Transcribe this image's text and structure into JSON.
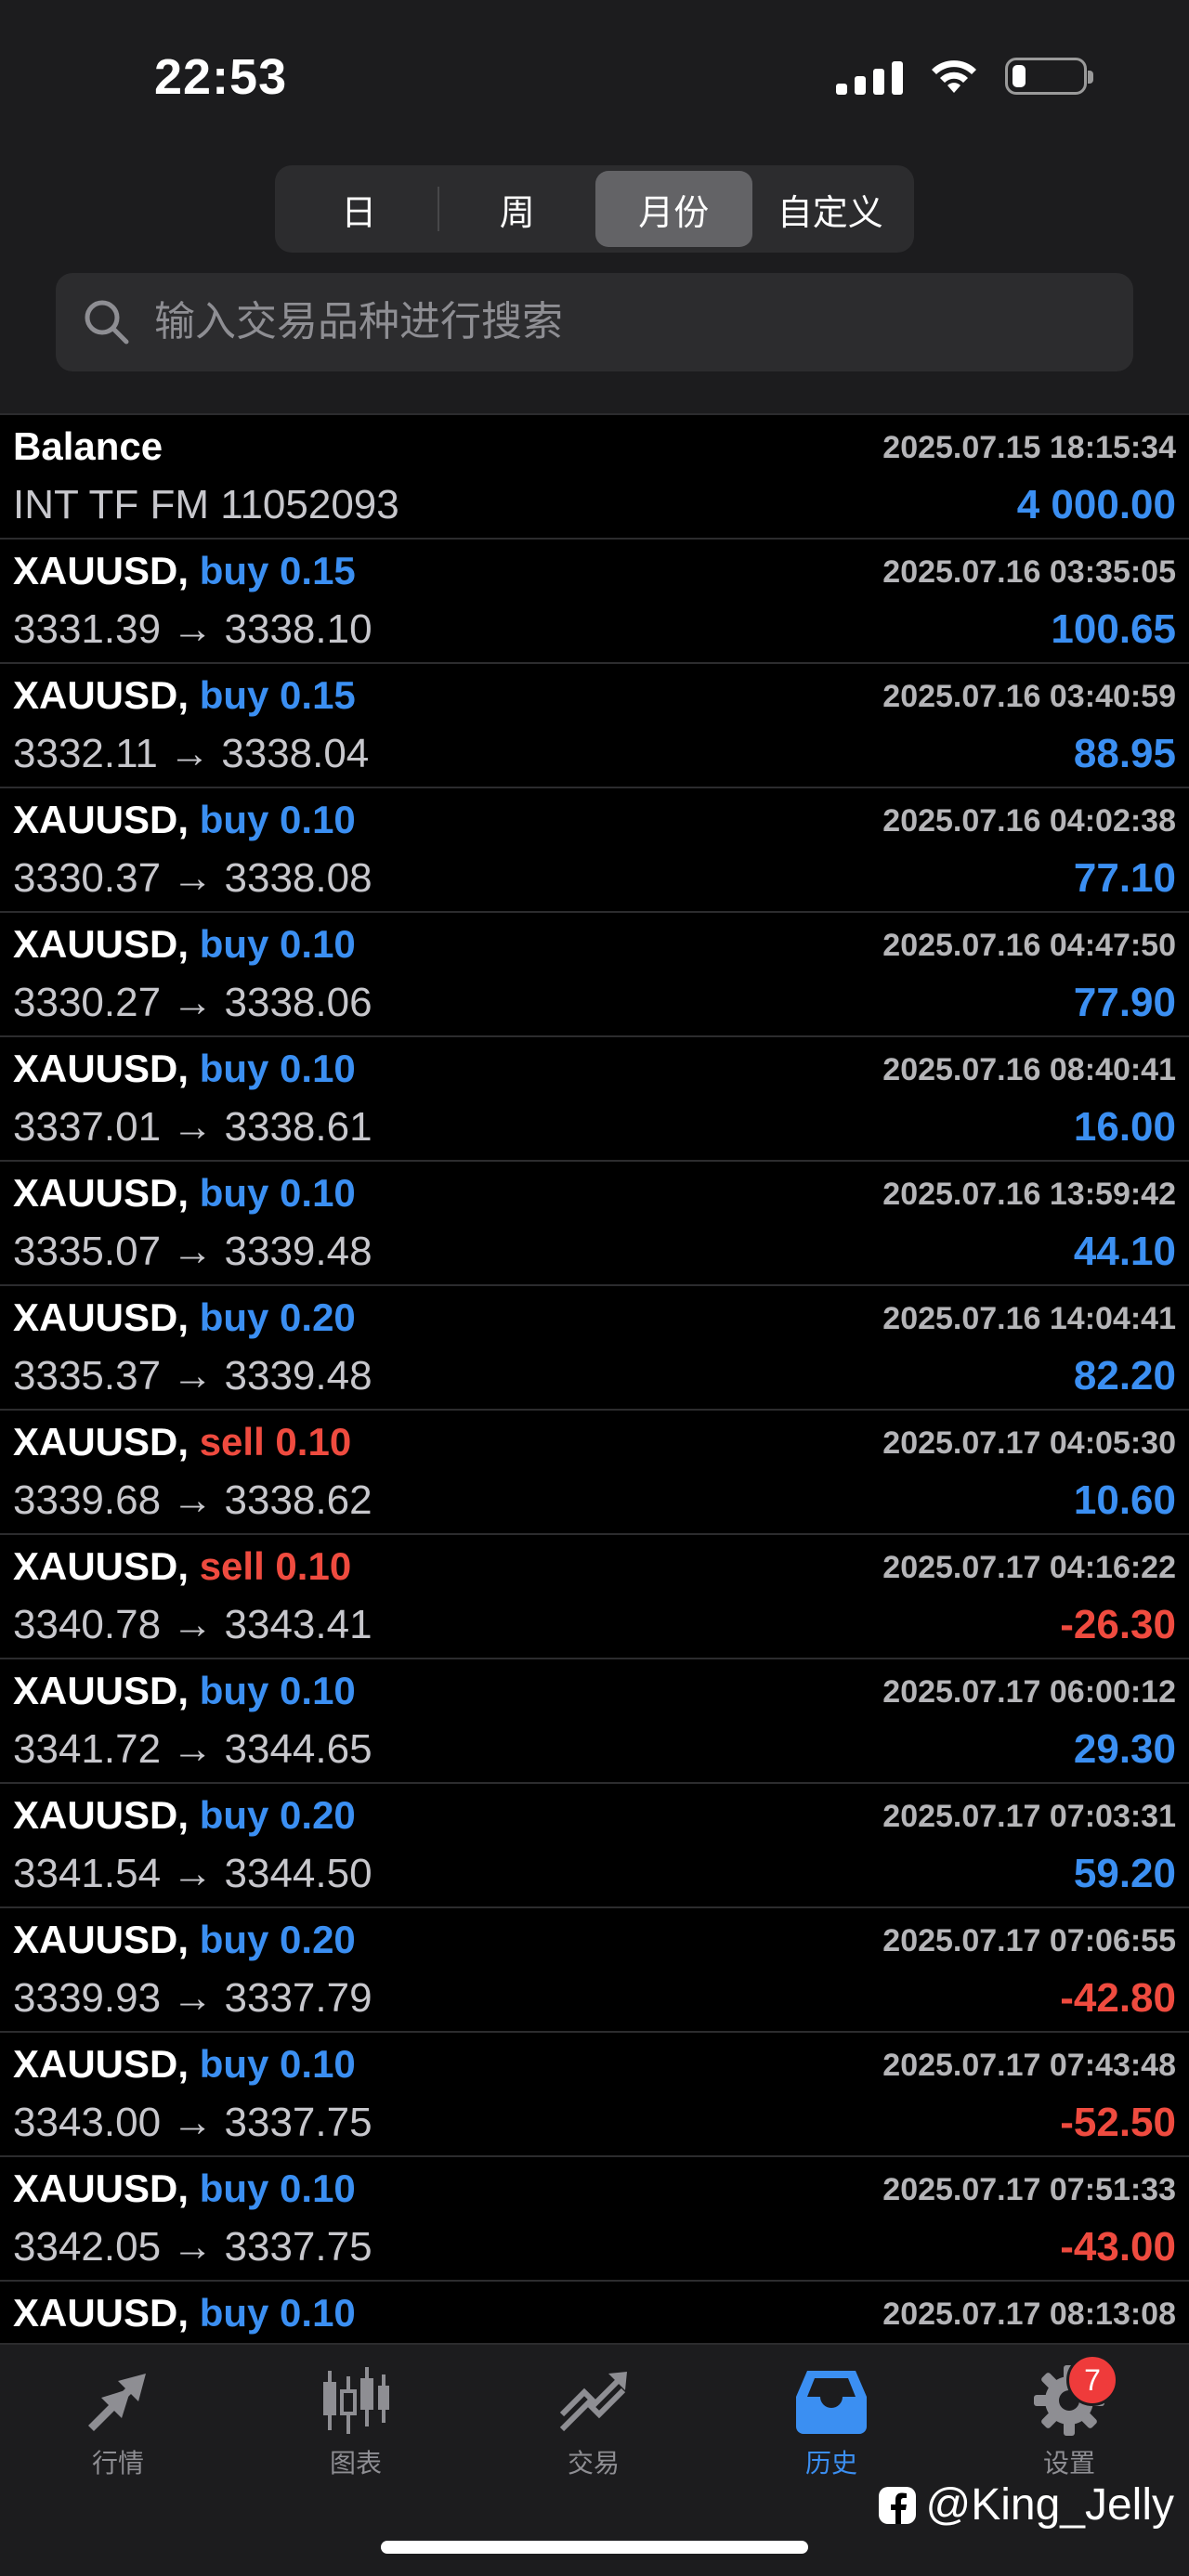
{
  "status": {
    "time": "22:53"
  },
  "period_tabs": [
    {
      "label": "日",
      "active": false
    },
    {
      "label": "周",
      "active": false
    },
    {
      "label": "月份",
      "active": true
    },
    {
      "label": "自定义",
      "active": false
    }
  ],
  "search": {
    "placeholder": "输入交易品种进行搜索"
  },
  "balance_row": {
    "title": "Balance",
    "time": "2025.07.15 18:15:34",
    "account": "INT TF FM 11052093",
    "amount": "4 000.00"
  },
  "trades": [
    {
      "symbol": "XAUUSD,",
      "side": "buy 0.15",
      "dir": "buy",
      "time": "2025.07.16 03:35:05",
      "prices": "3331.39 → 3338.10",
      "profit": "100.65",
      "sign": "pos"
    },
    {
      "symbol": "XAUUSD,",
      "side": "buy 0.15",
      "dir": "buy",
      "time": "2025.07.16 03:40:59",
      "prices": "3332.11 → 3338.04",
      "profit": "88.95",
      "sign": "pos"
    },
    {
      "symbol": "XAUUSD,",
      "side": "buy 0.10",
      "dir": "buy",
      "time": "2025.07.16 04:02:38",
      "prices": "3330.37 → 3338.08",
      "profit": "77.10",
      "sign": "pos"
    },
    {
      "symbol": "XAUUSD,",
      "side": "buy 0.10",
      "dir": "buy",
      "time": "2025.07.16 04:47:50",
      "prices": "3330.27 → 3338.06",
      "profit": "77.90",
      "sign": "pos"
    },
    {
      "symbol": "XAUUSD,",
      "side": "buy 0.10",
      "dir": "buy",
      "time": "2025.07.16 08:40:41",
      "prices": "3337.01 → 3338.61",
      "profit": "16.00",
      "sign": "pos"
    },
    {
      "symbol": "XAUUSD,",
      "side": "buy 0.10",
      "dir": "buy",
      "time": "2025.07.16 13:59:42",
      "prices": "3335.07 → 3339.48",
      "profit": "44.10",
      "sign": "pos"
    },
    {
      "symbol": "XAUUSD,",
      "side": "buy 0.20",
      "dir": "buy",
      "time": "2025.07.16 14:04:41",
      "prices": "3335.37 → 3339.48",
      "profit": "82.20",
      "sign": "pos"
    },
    {
      "symbol": "XAUUSD,",
      "side": "sell 0.10",
      "dir": "sell",
      "time": "2025.07.17 04:05:30",
      "prices": "3339.68 → 3338.62",
      "profit": "10.60",
      "sign": "pos"
    },
    {
      "symbol": "XAUUSD,",
      "side": "sell 0.10",
      "dir": "sell",
      "time": "2025.07.17 04:16:22",
      "prices": "3340.78 → 3343.41",
      "profit": "-26.30",
      "sign": "neg"
    },
    {
      "symbol": "XAUUSD,",
      "side": "buy 0.10",
      "dir": "buy",
      "time": "2025.07.17 06:00:12",
      "prices": "3341.72 → 3344.65",
      "profit": "29.30",
      "sign": "pos"
    },
    {
      "symbol": "XAUUSD,",
      "side": "buy 0.20",
      "dir": "buy",
      "time": "2025.07.17 07:03:31",
      "prices": "3341.54 → 3344.50",
      "profit": "59.20",
      "sign": "pos"
    },
    {
      "symbol": "XAUUSD,",
      "side": "buy 0.20",
      "dir": "buy",
      "time": "2025.07.17 07:06:55",
      "prices": "3339.93 → 3337.79",
      "profit": "-42.80",
      "sign": "neg"
    },
    {
      "symbol": "XAUUSD,",
      "side": "buy 0.10",
      "dir": "buy",
      "time": "2025.07.17 07:43:48",
      "prices": "3343.00 → 3337.75",
      "profit": "-52.50",
      "sign": "neg"
    },
    {
      "symbol": "XAUUSD,",
      "side": "buy 0.10",
      "dir": "buy",
      "time": "2025.07.17 07:51:33",
      "prices": "3342.05 → 3337.75",
      "profit": "-43.00",
      "sign": "neg"
    },
    {
      "symbol": "XAUUSD,",
      "side": "buy 0.10",
      "dir": "buy",
      "time": "2025.07.17 08:13:08",
      "prices": "",
      "profit": "",
      "sign": "pos"
    }
  ],
  "tabbar": [
    {
      "label": "行情",
      "icon": "quotes-icon",
      "active": false
    },
    {
      "label": "图表",
      "icon": "candlestick-chart-icon",
      "active": false
    },
    {
      "label": "交易",
      "icon": "trade-icon",
      "active": false
    },
    {
      "label": "历史",
      "icon": "history-inbox-icon",
      "active": true
    },
    {
      "label": "设置",
      "icon": "gear-icon",
      "active": false,
      "badge": "7"
    }
  ],
  "watermark": {
    "text": "@King_Jelly"
  },
  "colors": {
    "accent": "#3b8ff2",
    "loss": "#ef4b3f",
    "background": "#000000",
    "panel": "#1c1c1e"
  }
}
